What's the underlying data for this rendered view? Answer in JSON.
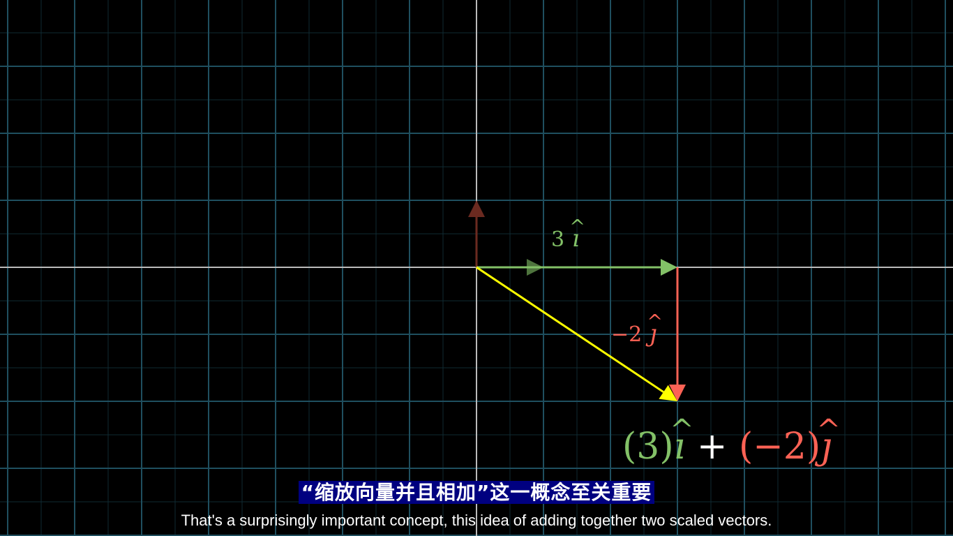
{
  "scene": {
    "colors": {
      "background": "#000000",
      "grid_line": "#1f4f5f",
      "grid_minor": "#0f2a32",
      "axis": "#bbbbbb",
      "i_hat": "#83c167",
      "j_hat": "#fc6255",
      "j_hat_basis": "#6b2a20",
      "sum_vector": "#ffff00"
    },
    "vectors": [
      {
        "name": "i-hat-basis",
        "x": 1,
        "y": 0
      },
      {
        "name": "j-hat-basis",
        "x": 0,
        "y": 1
      },
      {
        "name": "scaled-i-hat",
        "x": 3,
        "y": 0
      },
      {
        "name": "scaled-j-hat",
        "x": 0,
        "y": -2
      },
      {
        "name": "sum-vector",
        "x": 3,
        "y": -2
      }
    ]
  },
  "labels": {
    "scaled_i": {
      "coef": "3",
      "basis": "ı"
    },
    "scaled_j": {
      "coef": "−2",
      "basis": "ȷ"
    },
    "expression": {
      "part1": "(3)",
      "basis1": "ı",
      "plus": "+",
      "part2": "(−2)",
      "basis2": "ȷ"
    }
  },
  "subtitles": {
    "chinese": "“缩放向量并且相加”这一概念至关重要",
    "english": "That's a surprisingly important concept, this idea of adding together two scaled vectors."
  }
}
